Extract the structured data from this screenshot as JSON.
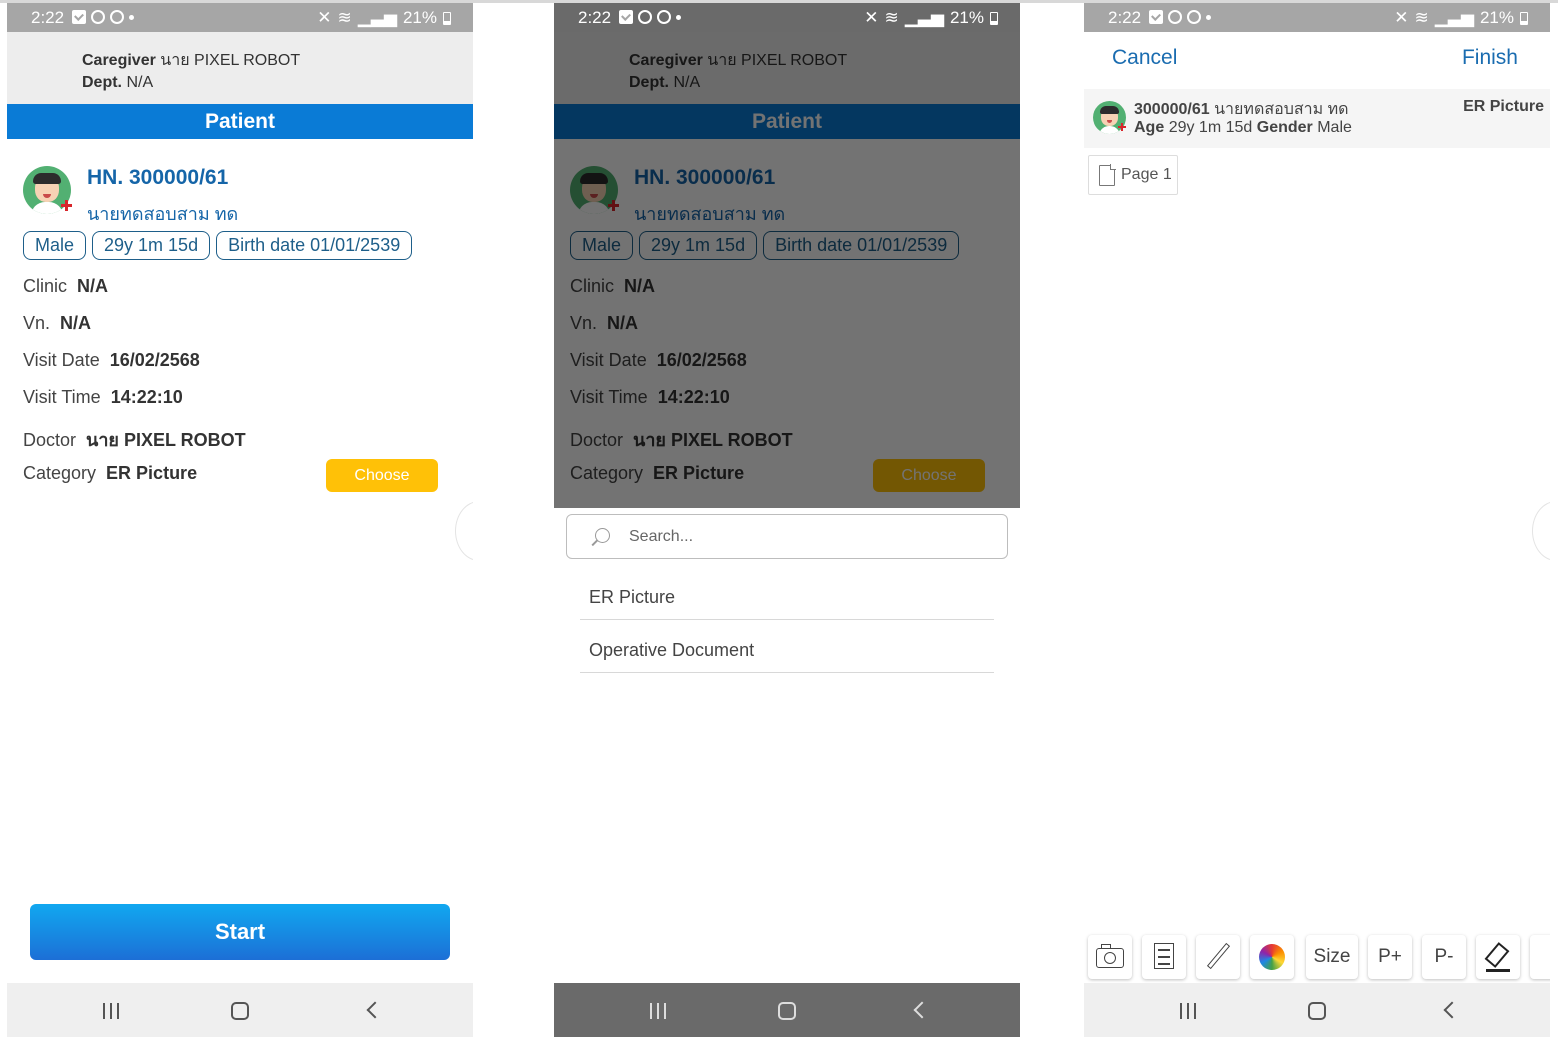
{
  "status": {
    "time": "2:22",
    "battery": "21%"
  },
  "caregiver": {
    "label": "Caregiver",
    "name": "นาย PIXEL ROBOT",
    "dept_label": "Dept.",
    "dept": "N/A"
  },
  "patient": {
    "header": "Patient",
    "hn": "HN. 300000/61",
    "name": "นายทดสอบสาม ทด",
    "chips": [
      "Male",
      "29y 1m 15d",
      "Birth date 01/01/2539"
    ],
    "rows": [
      {
        "label": "Clinic",
        "value": "N/A"
      },
      {
        "label": "Vn.",
        "value": "N/A"
      },
      {
        "label": "Visit Date",
        "value": "16/02/2568"
      },
      {
        "label": "Visit Time",
        "value": "14:22:10"
      },
      {
        "label": "Doctor",
        "value": "นาย PIXEL ROBOT"
      },
      {
        "label": "Category",
        "value": "ER Picture"
      }
    ],
    "choose_label": "Choose",
    "start_label": "Start"
  },
  "picker": {
    "search_placeholder": "Search...",
    "options": [
      "ER Picture",
      "Operative Document"
    ]
  },
  "editor": {
    "cancel_label": "Cancel",
    "finish_label": "Finish",
    "card_hn": "300000/61",
    "card_name": "นายทดสอบสาม ทด",
    "age_label": "Age",
    "age": "29y 1m 15d",
    "gender_label": "Gender",
    "gender": "Male",
    "category": "ER Picture",
    "page_tab": "Page 1",
    "tools": {
      "size": "Size",
      "page_plus": "P+",
      "page_minus": "P-"
    },
    "tool_icons": [
      "camera-icon",
      "insert-page-icon",
      "pencil-icon",
      "color-wheel-icon",
      "highlighter-icon"
    ]
  },
  "colors": {
    "status_bar": "#a6a6a6",
    "patient_bar": "#0a7bd6",
    "accent_text": "#1565a8",
    "choose_button": "#ffc107",
    "start_button": "#1c6fd6"
  }
}
